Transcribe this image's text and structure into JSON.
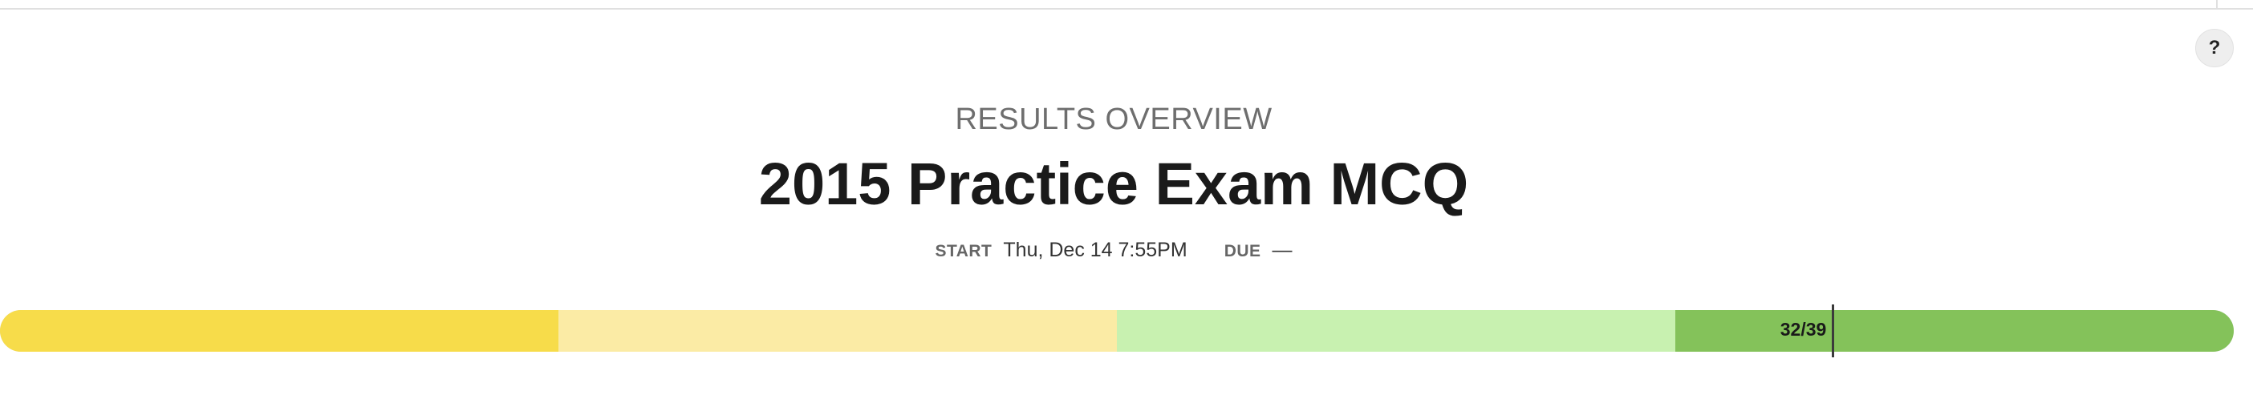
{
  "header": {
    "help_label": "?",
    "subtitle": "RESULTS OVERVIEW",
    "title": "2015 Practice Exam MCQ"
  },
  "meta": {
    "start_label": "START",
    "start_value": "Thu, Dec 14 7:55PM",
    "due_label": "DUE",
    "due_value": "—"
  },
  "progress": {
    "score_label": "32/39",
    "score": 32,
    "total": 39,
    "segment_colors": [
      "#f7dc4a",
      "#fbeba5",
      "#c8f1b0",
      "#84c25a"
    ]
  }
}
